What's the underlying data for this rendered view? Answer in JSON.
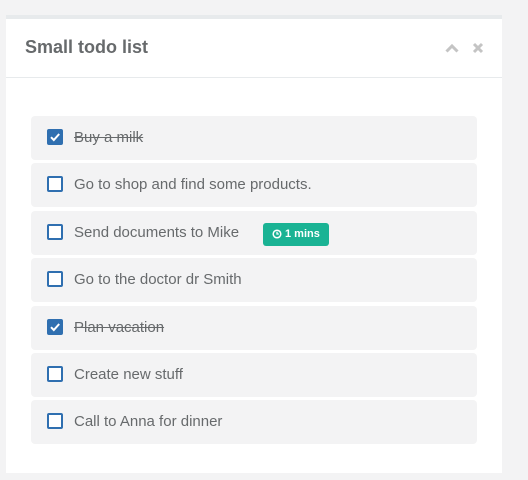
{
  "panel": {
    "title": "Small todo list",
    "tools": [
      "chevron-up-icon",
      "close-icon"
    ]
  },
  "todos": [
    {
      "label": "Buy a milk",
      "checked": true
    },
    {
      "label": "Go to shop and find some products.",
      "checked": false
    },
    {
      "label": "Send documents to Mike",
      "checked": false,
      "badge": "1 mins",
      "badge_color": "#1ab394"
    },
    {
      "label": "Go to the doctor dr Smith",
      "checked": false
    },
    {
      "label": "Plan vacation",
      "checked": true
    },
    {
      "label": "Create new stuff",
      "checked": false
    },
    {
      "label": "Call to Anna for dinner",
      "checked": false
    }
  ],
  "colors": {
    "accent": "#2f6fb0",
    "badge": "#1ab394",
    "text": "#676a6c",
    "item_bg": "#f3f3f4"
  }
}
